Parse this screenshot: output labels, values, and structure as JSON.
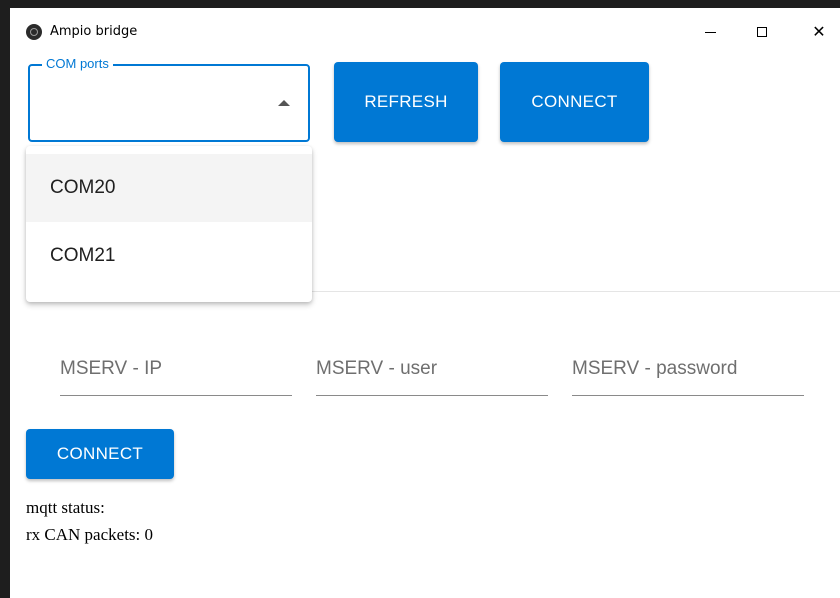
{
  "window": {
    "title": "Ampio bridge"
  },
  "controls": {
    "minimize": "—",
    "maximize": "☐",
    "close": "✕"
  },
  "com_select": {
    "label": "COM ports",
    "value": ""
  },
  "buttons": {
    "refresh": "REFRESH",
    "connect_serial": "CONNECT",
    "connect_mqtt": "CONNECT"
  },
  "dropdown": {
    "options": [
      "COM20",
      "COM21"
    ],
    "highlighted": "COM20"
  },
  "fields": {
    "ip_placeholder": "MSERV - IP",
    "user_placeholder": "MSERV - user",
    "password_placeholder": "MSERV - password"
  },
  "status": {
    "mqtt_label": "mqtt status:",
    "mqtt_value": "",
    "rx_label": "rx CAN packets:",
    "rx_count": "0"
  },
  "colors": {
    "accent": "#0078d4"
  }
}
